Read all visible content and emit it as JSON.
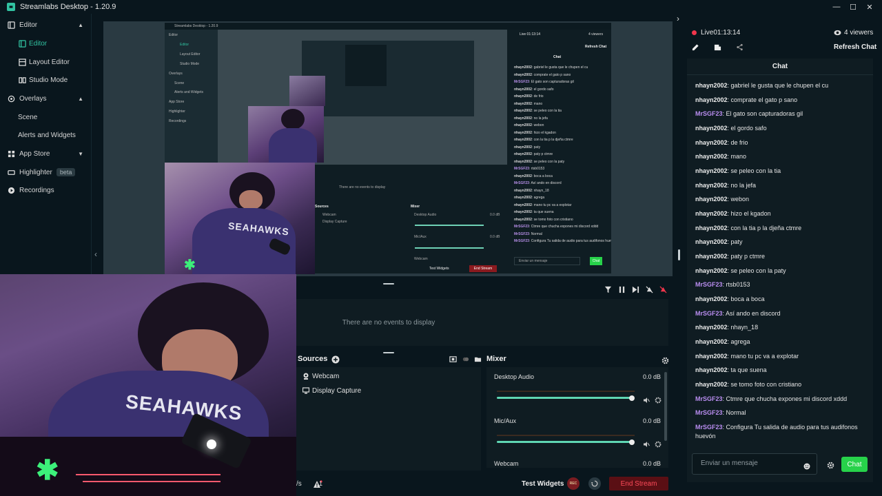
{
  "window": {
    "title": "Streamlabs Desktop - 1.20.9",
    "controls": [
      "—",
      "☐",
      "✕"
    ]
  },
  "sidebar": {
    "items": [
      {
        "label": "Editor",
        "icon": "editor-icon"
      },
      {
        "label": "Editor",
        "icon": "editor-small-icon",
        "active": true
      },
      {
        "label": "Layout Editor",
        "icon": "layout-icon"
      },
      {
        "label": "Studio Mode",
        "icon": "studio-mode-icon"
      },
      {
        "label": "Overlays",
        "icon": "overlays-icon"
      },
      {
        "label": "Scene"
      },
      {
        "label": "Alerts and Widgets"
      },
      {
        "label": "App Store",
        "icon": "app-store-icon"
      },
      {
        "label": "Highlighter",
        "icon": "highlighter-icon",
        "badge": "beta"
      },
      {
        "label": "Recordings",
        "icon": "recordings-icon"
      }
    ]
  },
  "preview": {
    "nested_title": "Streamlabs Desktop - 1.20.9",
    "nested_sidebar": [
      "Editor",
      "Editor",
      "Layout Editor",
      "Studio Mode",
      "Overlays",
      "Scene",
      "Alerts and Widgets",
      "App Store",
      "Highlighter",
      "Recordings"
    ],
    "nested_live": "Live 01:13:14",
    "nested_viewers": "4 viewers",
    "nested_refresh": "Refresh Chat",
    "nested_chat_header": "Chat",
    "nested_events_empty": "There are no events to display",
    "nested_sources": "Sources",
    "nested_mixer": "Mixer",
    "nested_webcam": "Webcam",
    "nested_display": "Display Capture",
    "nested_desktop_audio": "Desktop Audio",
    "nested_mic": "Mic/Aux",
    "nested_webcam_mix": "Webcam",
    "nested_db": "0.0 dB",
    "nested_test_widgets": "Test Widgets",
    "nested_end_stream": "End Stream",
    "nested_chat_input": "Enviar un mensaje",
    "nested_chat_btn": "Chat",
    "cam_text": "SEAHAWKS"
  },
  "events": {
    "empty_text": "There are no events to display"
  },
  "sources": {
    "title": "Sources",
    "items": [
      {
        "label": "Webcam",
        "icon": "webcam-icon"
      },
      {
        "label": "Display Capture",
        "icon": "display-capture-icon"
      }
    ]
  },
  "mixer": {
    "title": "Mixer",
    "channels": [
      {
        "label": "Desktop Audio",
        "db": "0.0 dB",
        "level": 1.0
      },
      {
        "label": "Mic/Aux",
        "db": "0.0 dB",
        "level": 1.0
      },
      {
        "label": "Webcam",
        "db": "0.0 dB",
        "level": 1.0
      }
    ]
  },
  "footer": {
    "fragment": "/s",
    "warning_count": "1",
    "test_widgets": "Test Widgets",
    "rec_label": "REC",
    "end_stream": "End Stream"
  },
  "stream": {
    "live_label": "Live",
    "live_time": "01:13:14",
    "viewers": "4 viewers",
    "refresh_chat": "Refresh Chat"
  },
  "chat": {
    "header": "Chat",
    "messages": [
      {
        "user": "nhayn2002",
        "text": ": gabriel le gusta que le chupen el cu"
      },
      {
        "user": "nhayn2002",
        "text": ": comprate el gato p sano"
      },
      {
        "user": "MrSGF23",
        "text": ": El gato son capturadoras gil"
      },
      {
        "user": "nhayn2002",
        "text": ": el gordo safo"
      },
      {
        "user": "nhayn2002",
        "text": ": de frio"
      },
      {
        "user": "nhayn2002",
        "text": ": mano"
      },
      {
        "user": "nhayn2002",
        "text": ": se peleo con la tia"
      },
      {
        "user": "nhayn2002",
        "text": ": no la jefa"
      },
      {
        "user": "nhayn2002",
        "text": ": webon"
      },
      {
        "user": "nhayn2002",
        "text": ": hizo el kgadon"
      },
      {
        "user": "nhayn2002",
        "text": ": con la tia p la djeña ctmre"
      },
      {
        "user": "nhayn2002",
        "text": ": paty"
      },
      {
        "user": "nhayn2002",
        "text": ": paty p ctmre"
      },
      {
        "user": "nhayn2002",
        "text": ": se peleo con la paty"
      },
      {
        "user": "MrSGF23",
        "text": ": rtsb0153"
      },
      {
        "user": "nhayn2002",
        "text": ": boca a boca"
      },
      {
        "user": "MrSGF23",
        "text": ": Así ando en discord"
      },
      {
        "user": "nhayn2002",
        "text": ": nhayn_18"
      },
      {
        "user": "nhayn2002",
        "text": ": agrega"
      },
      {
        "user": "nhayn2002",
        "text": ": mano tu pc va a explotar"
      },
      {
        "user": "nhayn2002",
        "text": ": ta que suena"
      },
      {
        "user": "nhayn2002",
        "text": ": se tomo foto con cristiano"
      },
      {
        "user": "MrSGF23",
        "text": ": Ctmre que chucha expones mi discord xddd"
      },
      {
        "user": "MrSGF23",
        "text": ": Normal"
      },
      {
        "user": "MrSGF23",
        "text": ": Configura Tu salida de audio para tus audifonos huevón"
      }
    ],
    "input_placeholder": "Enviar un mensaje",
    "send_label": "Chat"
  },
  "colors": {
    "accent": "#31c3a2",
    "chat_button": "#27d24a",
    "mod_user": "#b98df0",
    "live": "#f2364c",
    "end_stream_bg": "#5a0f14"
  }
}
